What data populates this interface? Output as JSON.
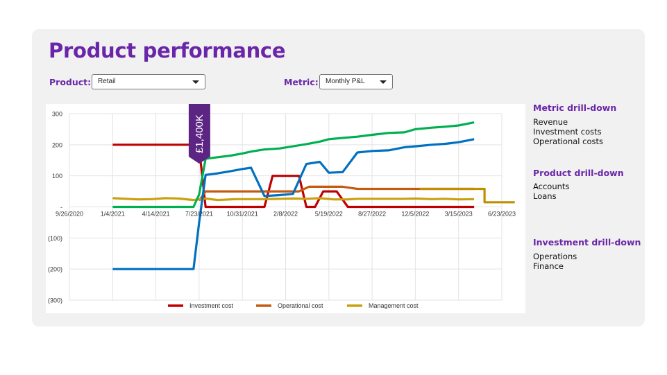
{
  "page": {
    "title": "Product performance"
  },
  "controls": {
    "product_label": "Product:",
    "product_value": "Retail",
    "metric_label": "Metric:",
    "metric_value": "Monthly P&L"
  },
  "sidebar": {
    "sections": [
      {
        "heading": "Metric drill-down",
        "items": [
          "Revenue",
          "Investment costs",
          "Operational costs"
        ]
      },
      {
        "heading": "Product drill-down",
        "items": [
          "Accounts",
          "Loans"
        ]
      },
      {
        "heading": "Investment drill-down",
        "items": [
          "Operations",
          "Finance"
        ]
      }
    ]
  },
  "chart_data": {
    "type": "line",
    "x_tick_labels": [
      "9/26/2020",
      "1/4/2021",
      "4/14/2021",
      "7/23/2021",
      "10/31/2021",
      "2/8/2022",
      "5/19/2022",
      "8/27/2022",
      "12/5/2022",
      "3/15/2023",
      "6/23/2023"
    ],
    "y_tick_values": [
      300,
      200,
      100,
      0,
      -100,
      -200,
      -300
    ],
    "y_tick_labels": [
      "300",
      "200",
      "100",
      "-",
      "(100)",
      "(200)",
      "(300)"
    ],
    "ylim": [
      -300,
      300
    ],
    "grid": true,
    "legend_position": "bottom",
    "callout": {
      "text": "£1,400K",
      "x": "7/23/2021",
      "color": "#5c2584"
    },
    "series": [
      {
        "name": "Investment cost",
        "color": "#c00000",
        "in_legend": true,
        "points": [
          [
            "1/4/2021",
            200
          ],
          [
            "6/24/2021",
            200
          ],
          [
            "7/10/2021",
            200
          ],
          [
            "7/23/2021",
            190
          ],
          [
            "8/7/2021",
            0
          ],
          [
            "2021-09",
            0
          ],
          [
            "2021-10",
            0
          ],
          [
            "2021-11",
            0
          ],
          [
            "12/21/2021",
            0
          ],
          [
            "1/9/2022",
            100
          ],
          [
            "2022-02",
            100
          ],
          [
            "2/25/2022",
            100
          ],
          [
            "3/11/2022",
            100
          ],
          [
            "3/28/2022",
            0
          ],
          [
            "4/17/2022",
            0
          ],
          [
            "5/6/2022",
            50
          ],
          [
            "6/6/2022",
            50
          ],
          [
            "7/2/2022",
            0
          ],
          [
            "2022-08",
            0
          ],
          [
            "2022-12",
            0
          ],
          [
            "4/20/2023",
            0
          ]
        ]
      },
      {
        "name": "Operational cost",
        "color": "#c55a11",
        "in_legend": true,
        "points": [
          [
            "7/23/2021",
            20
          ],
          [
            "8/7/2021",
            50
          ],
          [
            "2021-10",
            50
          ],
          [
            "2021-12",
            50
          ],
          [
            "2022-02",
            50
          ],
          [
            "3/11/2022",
            50
          ],
          [
            "4/3/2022",
            65
          ],
          [
            "2022-05",
            65
          ],
          [
            "6/20/2022",
            65
          ],
          [
            "7/24/2022",
            58
          ],
          [
            "8/27/2022",
            58
          ],
          [
            "2022-12",
            58
          ],
          [
            "3/15/2023",
            58
          ],
          [
            "4/20/2023",
            58
          ]
        ]
      },
      {
        "name": "Management cost",
        "color": "#c9a010",
        "in_legend": true,
        "points": [
          [
            "1/4/2021",
            28
          ],
          [
            "2/4/2021",
            26
          ],
          [
            "3/4/2021",
            24
          ],
          [
            "4/4/2021",
            25
          ],
          [
            "5/6/2021",
            28
          ],
          [
            "6/6/2021",
            27
          ],
          [
            "7/10/2021",
            22
          ],
          [
            "8/7/2021",
            27
          ],
          [
            "9/4/2021",
            22
          ],
          [
            "10/14/2021",
            25
          ],
          [
            "11/20/2021",
            25
          ],
          [
            "12/21/2021",
            25
          ],
          [
            "1/25/2022",
            26
          ],
          [
            "2/25/2022",
            27
          ],
          [
            "3/28/2022",
            26
          ],
          [
            "4/28/2022",
            28
          ],
          [
            "5/31/2022",
            24
          ],
          [
            "6/30/2022",
            24
          ],
          [
            "7/24/2022",
            26
          ],
          [
            "8/27/2022",
            26
          ],
          [
            "10/4/2022",
            26
          ],
          [
            "11/10/2022",
            26
          ],
          [
            "12/5/2022",
            27
          ],
          [
            "1/12/2023",
            25
          ],
          [
            "2/12/2023",
            26
          ],
          [
            "3/15/2023",
            24
          ],
          [
            "4/20/2023",
            25
          ]
        ]
      },
      {
        "name": "",
        "color": "#00b050",
        "in_legend": false,
        "points": [
          [
            "1/4/2021",
            0
          ],
          [
            "6/24/2021",
            0
          ],
          [
            "7/10/2021",
            0
          ],
          [
            "7/23/2021",
            40
          ],
          [
            "8/7/2021",
            155
          ],
          [
            "9/4/2021",
            160
          ],
          [
            "10/4/2021",
            165
          ],
          [
            "10/31/2021",
            172
          ],
          [
            "11/20/2021",
            178
          ],
          [
            "12/21/2021",
            185
          ],
          [
            "1/25/2022",
            188
          ],
          [
            "2/25/2022",
            195
          ],
          [
            "3/28/2022",
            202
          ],
          [
            "4/28/2022",
            210
          ],
          [
            "5/19/2022",
            218
          ],
          [
            "6/20/2022",
            222
          ],
          [
            "7/24/2022",
            226
          ],
          [
            "8/27/2022",
            232
          ],
          [
            "10/4/2022",
            238
          ],
          [
            "11/10/2022",
            240
          ],
          [
            "12/5/2022",
            250
          ],
          [
            "1/12/2023",
            255
          ],
          [
            "2/12/2023",
            258
          ],
          [
            "3/15/2023",
            262
          ],
          [
            "4/20/2023",
            272
          ]
        ]
      },
      {
        "name": "",
        "color": "#0070c0",
        "in_legend": false,
        "points": [
          [
            "1/4/2021",
            -200
          ],
          [
            "6/24/2021",
            -200
          ],
          [
            "7/10/2021",
            -200
          ],
          [
            "7/23/2021",
            -50
          ],
          [
            "8/7/2021",
            103
          ],
          [
            "9/4/2021",
            108
          ],
          [
            "10/4/2021",
            115
          ],
          [
            "10/31/2021",
            122
          ],
          [
            "11/20/2021",
            126
          ],
          [
            "12/21/2021",
            35
          ],
          [
            "1/25/2022",
            38
          ],
          [
            "2/25/2022",
            42
          ],
          [
            "3/28/2022",
            138
          ],
          [
            "4/28/2022",
            145
          ],
          [
            "5/19/2022",
            110
          ],
          [
            "6/20/2022",
            112
          ],
          [
            "7/24/2022",
            175
          ],
          [
            "8/27/2022",
            180
          ],
          [
            "10/4/2022",
            182
          ],
          [
            "11/10/2022",
            192
          ],
          [
            "12/5/2022",
            195
          ],
          [
            "1/12/2023",
            200
          ],
          [
            "2/12/2023",
            203
          ],
          [
            "3/15/2023",
            208
          ],
          [
            "4/20/2023",
            218
          ]
        ]
      },
      {
        "name": "",
        "color": "#bf8f00",
        "in_legend": false,
        "points": [
          [
            "2022-12",
            58
          ],
          [
            "3/15/2023",
            58
          ],
          [
            "4/20/2023",
            58
          ],
          [
            "5/14/2023",
            58
          ],
          [
            "5/14/2023",
            15
          ],
          [
            "6/23/2023",
            15
          ],
          [
            "7/23/2023",
            15
          ]
        ]
      }
    ]
  }
}
